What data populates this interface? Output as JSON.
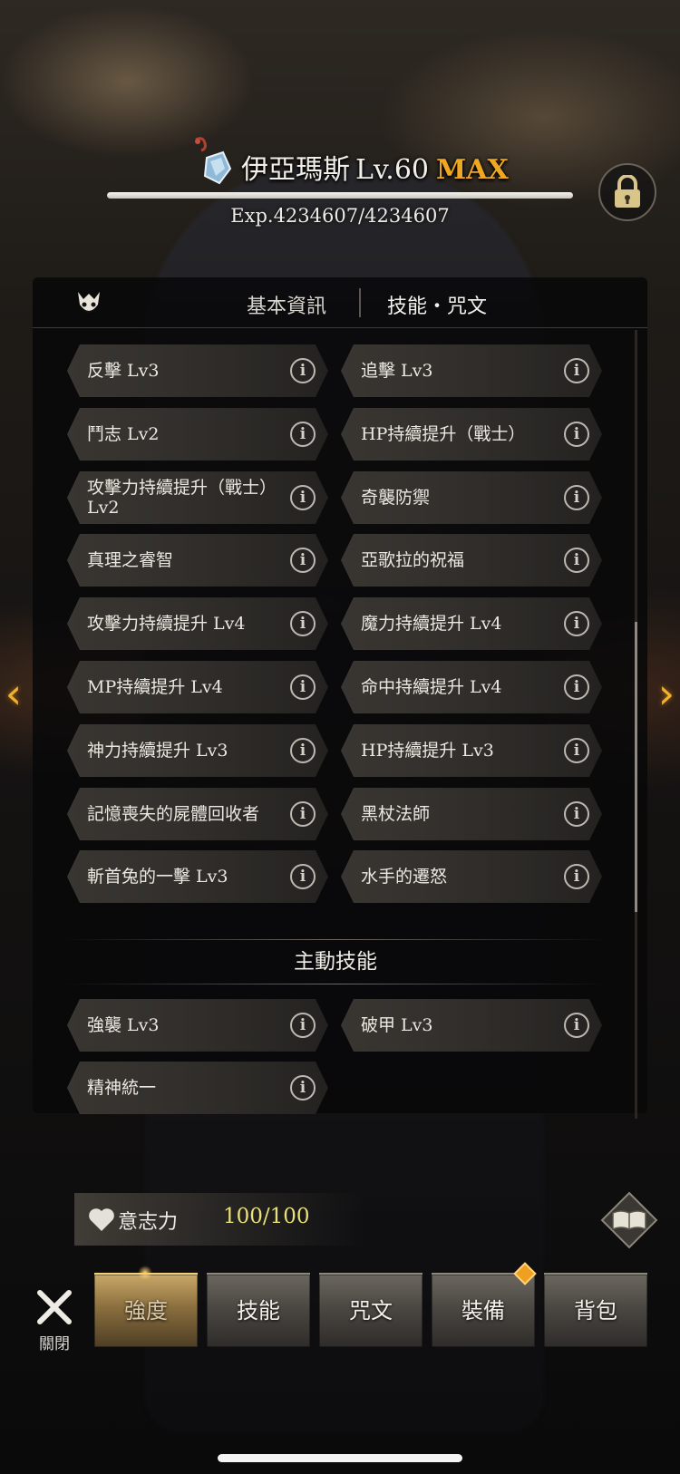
{
  "character": {
    "name": "伊亞瑪斯",
    "level": "Lv.60",
    "max_tag": "MAX",
    "exp_text": "Exp.4234607/4234607",
    "exp_progress": 1.0
  },
  "panel_tabs": {
    "info": "基本資訊",
    "skills": "技能・咒文",
    "active": "skills"
  },
  "passive_skills": [
    "反擊 Lv3",
    "追擊 Lv3",
    "鬥志 Lv2",
    "HP持續提升（戰士）",
    "攻擊力持續提升（戰士）Lv2",
    "奇襲防禦",
    "真理之睿智",
    "亞歌拉的祝福",
    "攻擊力持續提升 Lv4",
    "魔力持續提升 Lv4",
    "MP持續提升 Lv4",
    "命中持續提升 Lv4",
    "神力持續提升 Lv3",
    "HP持續提升 Lv3",
    "記憶喪失的屍體回收者",
    "黑杖法師",
    "斬首兔的一擊 Lv3",
    "水手的遷怒"
  ],
  "active_section_title": "主動技能",
  "active_skills": [
    "強襲 Lv3",
    "破甲 Lv3",
    "精神統一"
  ],
  "info_glyph": "i",
  "willpower": {
    "label": "意志力",
    "value": "100/100"
  },
  "close_label": "關閉",
  "bottom_tabs": [
    "強度",
    "技能",
    "咒文",
    "裝備",
    "背包"
  ],
  "active_bottom_tab": "強度",
  "colors": {
    "max": "#f0a820",
    "willpower_value": "#e9e07a",
    "accent": "#f0b030"
  },
  "icons": {
    "character": "crystal-charm-icon",
    "lock": "lock-icon",
    "emblem": "demon-emblem-icon",
    "info": "info-icon",
    "heart": "heart-icon",
    "book": "book-icon",
    "close": "close-icon",
    "prev": "chevron-left-icon",
    "next": "chevron-right-icon"
  }
}
